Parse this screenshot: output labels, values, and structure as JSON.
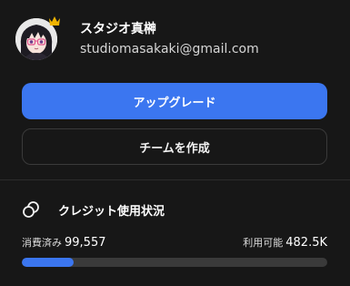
{
  "profile": {
    "display_name": "スタジオ真榊",
    "email": "studiomasakaki@gmail.com",
    "crown_color": "#f0b400"
  },
  "actions": {
    "upgrade_label": "アップグレード",
    "create_team_label": "チームを作成"
  },
  "usage": {
    "title": "クレジット使用状況",
    "icon": "coins-icon",
    "used_label": "消費済み",
    "used_value": "99,557",
    "available_label": "利用可能",
    "available_value": "482.5K",
    "progress_fraction": 0.17
  },
  "colors": {
    "accent": "#3b76f0",
    "background": "#171717",
    "track": "#3a3a3a"
  }
}
